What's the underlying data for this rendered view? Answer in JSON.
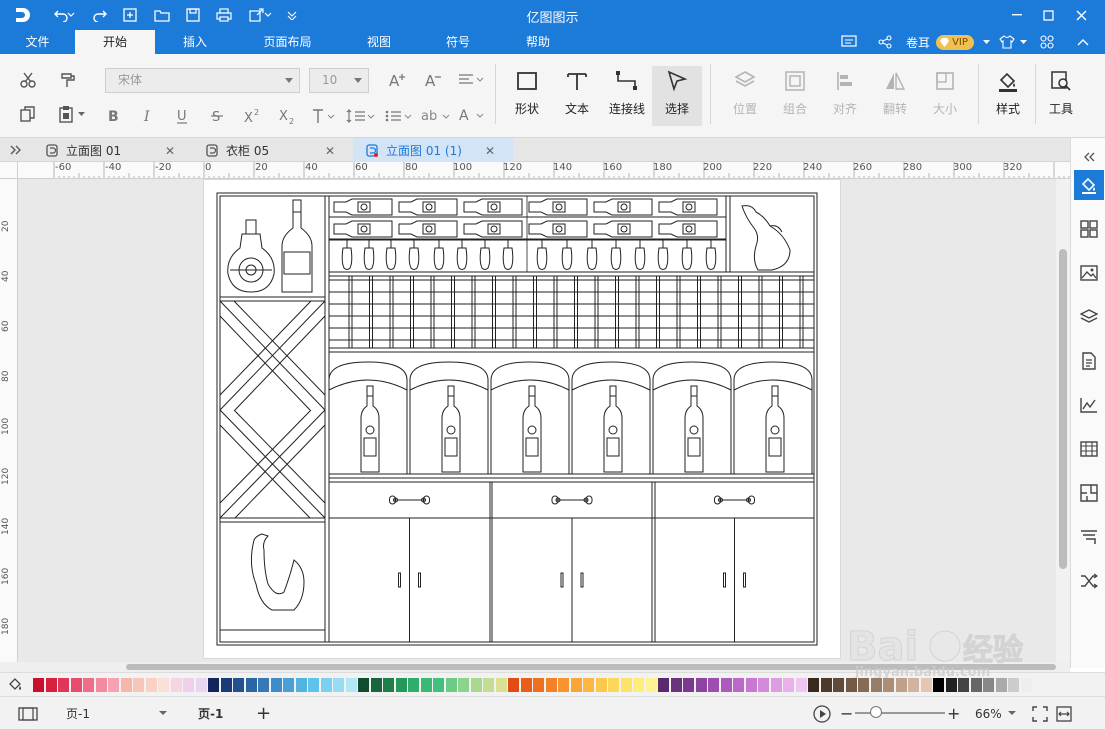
{
  "app": {
    "title": "亿图图示"
  },
  "menu": {
    "items": [
      {
        "label": "文件"
      },
      {
        "label": "开始"
      },
      {
        "label": "插入"
      },
      {
        "label": "页面布局"
      },
      {
        "label": "视图"
      },
      {
        "label": "符号"
      },
      {
        "label": "帮助"
      }
    ],
    "active": "开始",
    "user": "卷耳",
    "vip_badge": "VIP"
  },
  "ribbon": {
    "font_name": "宋体",
    "font_size": "10",
    "tools": [
      {
        "label": "形状"
      },
      {
        "label": "文本"
      },
      {
        "label": "连接线"
      },
      {
        "label": "选择"
      }
    ],
    "arrange": [
      {
        "label": "位置"
      },
      {
        "label": "组合"
      },
      {
        "label": "对齐"
      },
      {
        "label": "翻转"
      },
      {
        "label": "大小"
      }
    ],
    "style_label": "样式",
    "tools_label": "工具"
  },
  "tabs": [
    {
      "label": "立面图 01"
    },
    {
      "label": "衣柜 05"
    },
    {
      "label": "立面图 01 (1)"
    }
  ],
  "ruler": {
    "top": [
      "-60",
      "-40",
      "-20",
      "0",
      "20",
      "40",
      "60",
      "80",
      "100",
      "120",
      "140",
      "160",
      "180",
      "200",
      "220",
      "240",
      "260",
      "280",
      "300",
      "320"
    ],
    "left": [
      "20",
      "40",
      "60",
      "80",
      "100",
      "120",
      "140",
      "160",
      "180"
    ]
  },
  "status": {
    "page_selector": "页-1",
    "page_tab": "页-1",
    "zoom": "66%"
  },
  "colors": {
    "brand": "#1c7ad8",
    "palette": [
      "#c8102e",
      "#d6203c",
      "#e0365a",
      "#e84d6f",
      "#ee6d88",
      "#f28aa0",
      "#f5a3b3",
      "#f6b7a8",
      "#f7c6b8",
      "#f9d2c5",
      "#fae0d8",
      "#f5d6e0",
      "#efd0e8",
      "#e8d5ef",
      "#14245c",
      "#1b3a7a",
      "#23508f",
      "#2b66a4",
      "#3579b6",
      "#3f8cc6",
      "#4aa0d4",
      "#54b2e0",
      "#5ec3ea",
      "#7bd0ef",
      "#97dcf3",
      "#b3e6f7",
      "#0f4d2e",
      "#17663d",
      "#1f7f4c",
      "#27985b",
      "#30ae69",
      "#3ab874",
      "#44c07e",
      "#6ccb84",
      "#8cd38b",
      "#a9d98f",
      "#c4dd92",
      "#dbe095",
      "#e04c14",
      "#e85d1a",
      "#ef6f21",
      "#f48128",
      "#f79330",
      "#f9a538",
      "#fbb742",
      "#fcc84d",
      "#fdd75a",
      "#fde36a",
      "#feec7d",
      "#fef394",
      "#5a2a6e",
      "#6b327e",
      "#7c3a8f",
      "#8d43a0",
      "#9e4db0",
      "#ad5abd",
      "#bb68c8",
      "#c878d2",
      "#d48adb",
      "#de9de3",
      "#e8b1ea",
      "#f0c5f1",
      "#3a2a1e",
      "#4d3a2b",
      "#604a38",
      "#735a46",
      "#866b55",
      "#997c65",
      "#ac8e77",
      "#bfa08a",
      "#d2b39e",
      "#e4c6b3",
      "#000000",
      "#222222",
      "#444444",
      "#666666",
      "#888888",
      "#aaaaaa",
      "#cccccc",
      "#eeeeee"
    ]
  }
}
